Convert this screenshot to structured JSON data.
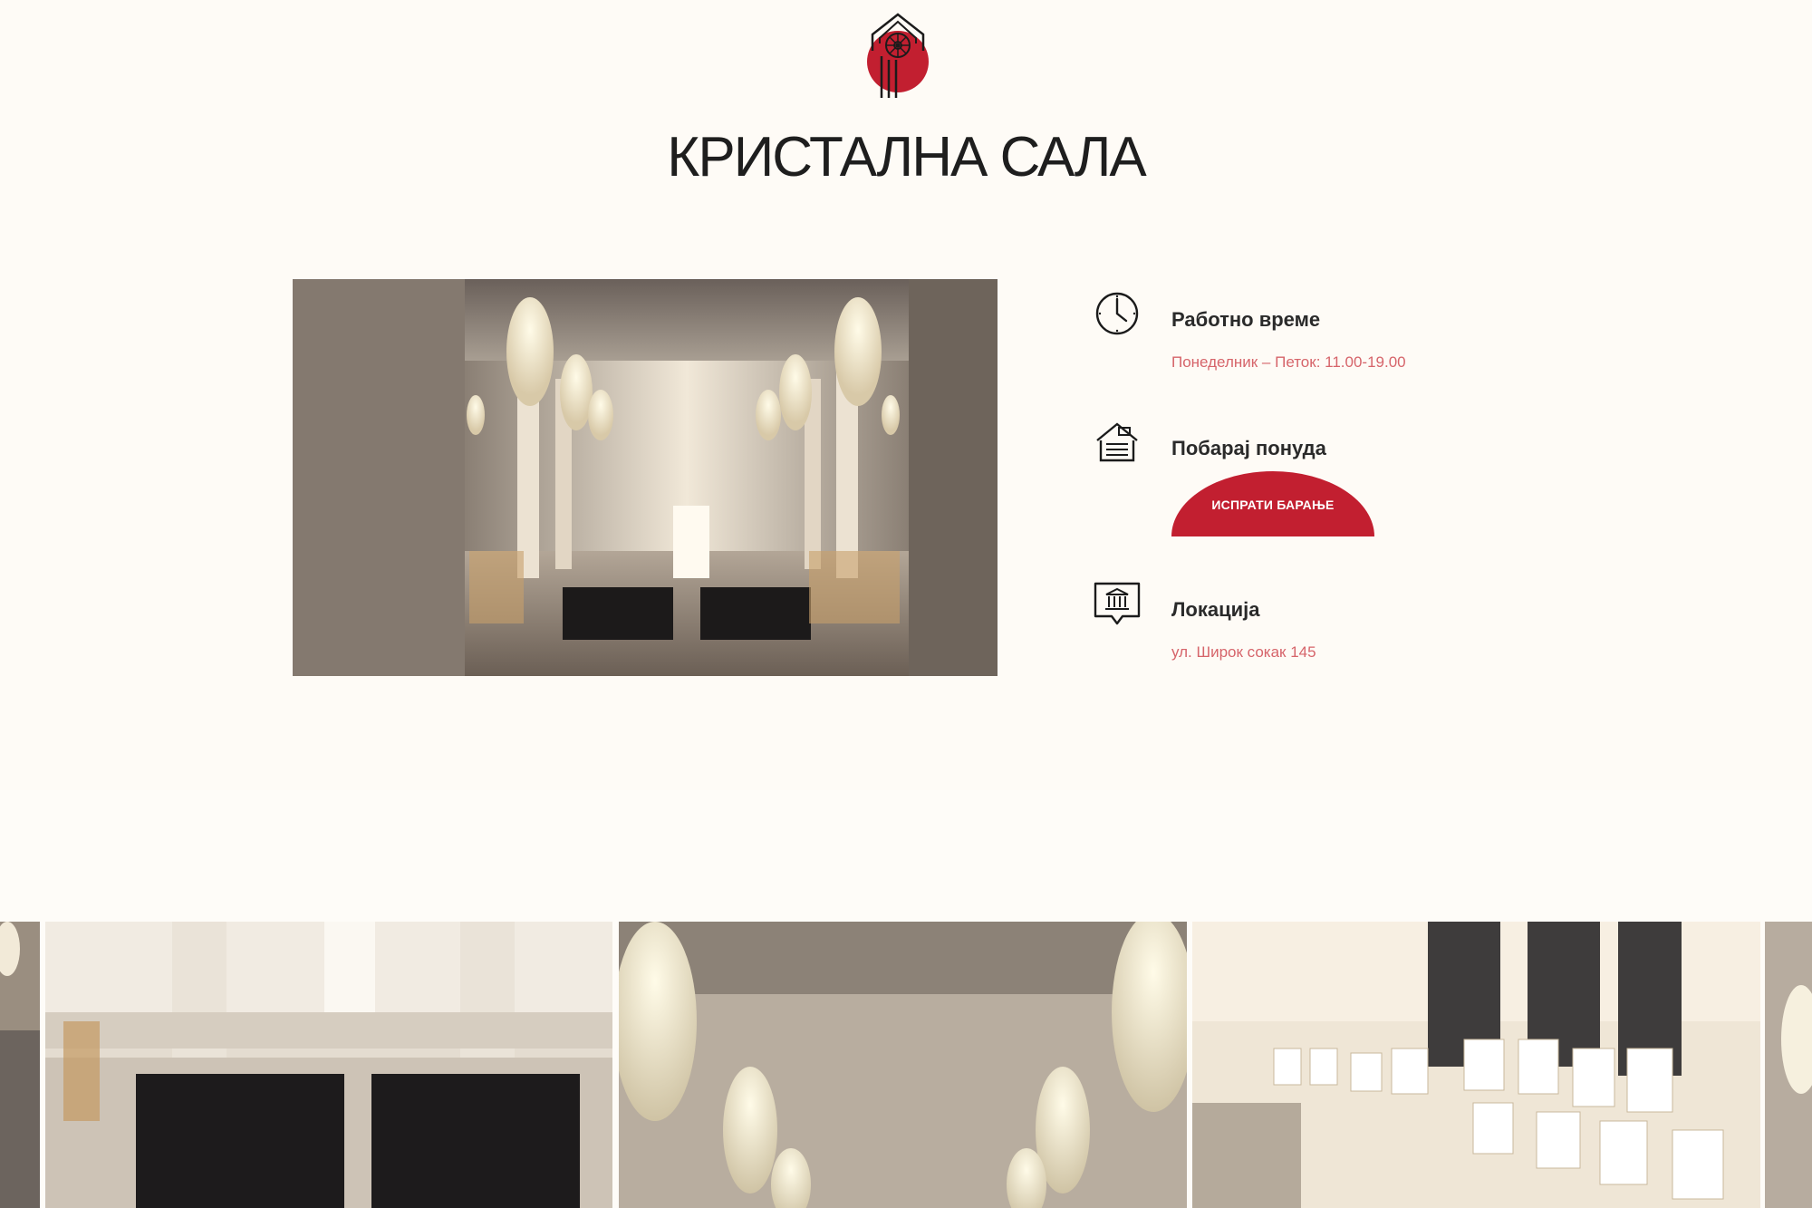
{
  "venue": {
    "title": "КРИСТАЛНА САЛА"
  },
  "info": {
    "hours": {
      "title": "Работно време",
      "value": "Понеделник – Петок: 11.00-19.00",
      "icon": "clock-icon"
    },
    "quote": {
      "title": "Побарај понуда",
      "button_label": "ИСПРАТИ БАРАЊЕ",
      "icon": "building-request-icon"
    },
    "location": {
      "title": "Локација",
      "value": "ул. Широк сокак 145",
      "icon": "museum-pin-icon"
    }
  },
  "colors": {
    "accent": "#c21f30",
    "accent_text": "#d6646a",
    "background": "#fefbf6"
  }
}
